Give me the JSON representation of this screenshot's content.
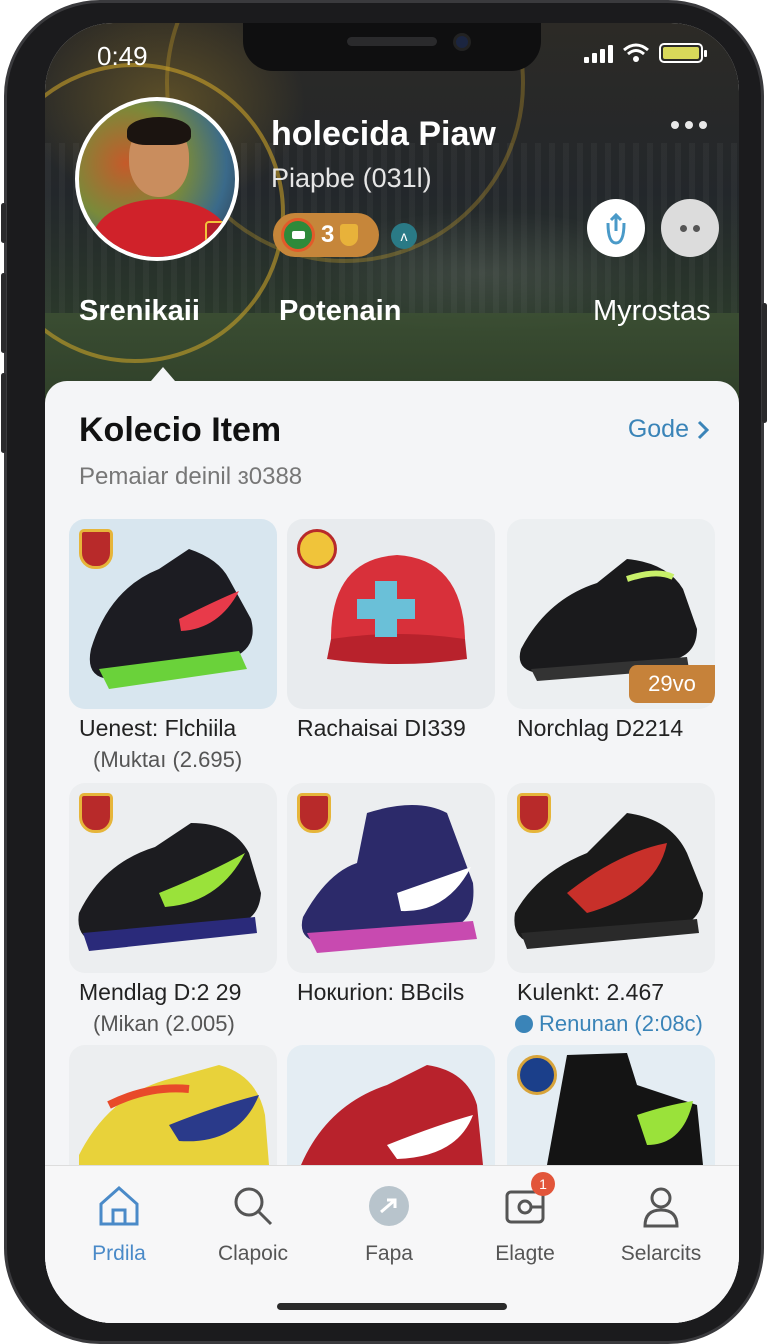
{
  "status": {
    "time": "0:49"
  },
  "profile": {
    "name": "holecida Piaw",
    "subtitle": "Piapbe (031l)",
    "badge_count": "3",
    "mini_badge": "ʌ"
  },
  "tabs": [
    {
      "label": "Srenikaii"
    },
    {
      "label": "Potenain"
    },
    {
      "label": "Myrostas"
    }
  ],
  "section": {
    "title": "Kolecio Item",
    "link": "Gode",
    "subtitle": "Pemaiar deinil ɜ0388"
  },
  "items": [
    {
      "name": "Uenest: Flchiila",
      "detail": "(Muktaı (2.695)",
      "image": "black-running-shoe",
      "crest": "club-crest"
    },
    {
      "name": "Rachaisai DI339",
      "detail": "",
      "image": "red-cap",
      "crest": "round-crest"
    },
    {
      "name": "Norchlag D2214",
      "detail": "",
      "image": "black-trail-shoe",
      "price": "29vo"
    },
    {
      "name": "Mendlag D:2 29",
      "detail": "(Mikan (2.005)",
      "image": "black-neon-shoe",
      "crest": "club-crest"
    },
    {
      "name": "Hoкurion: BBcils",
      "detail": "",
      "image": "purple-high-shoe",
      "crest": "club-crest"
    },
    {
      "name": "Kulenkt: 2.467",
      "detail": "Renunan (2:08c)",
      "image": "black-red-shoe",
      "crest": "club-crest"
    },
    {
      "name": "",
      "detail": "",
      "image": "yellow-shoe"
    },
    {
      "name": "",
      "detail": "",
      "image": "red-shoe"
    },
    {
      "name": "",
      "detail": "",
      "image": "black-boot",
      "crest": "globe-crest"
    }
  ],
  "nav": [
    {
      "label": "Prdila",
      "icon": "home-icon"
    },
    {
      "label": "Clapoic",
      "icon": "search-icon"
    },
    {
      "label": "Fapa",
      "icon": "arrow-icon"
    },
    {
      "label": "Elagte",
      "icon": "wallet-icon",
      "badge": "1"
    },
    {
      "label": "Selarcits",
      "icon": "user-icon"
    }
  ],
  "colors": {
    "accent": "#3a84b8",
    "gold": "#c6823a",
    "badge": "#e2553a"
  }
}
